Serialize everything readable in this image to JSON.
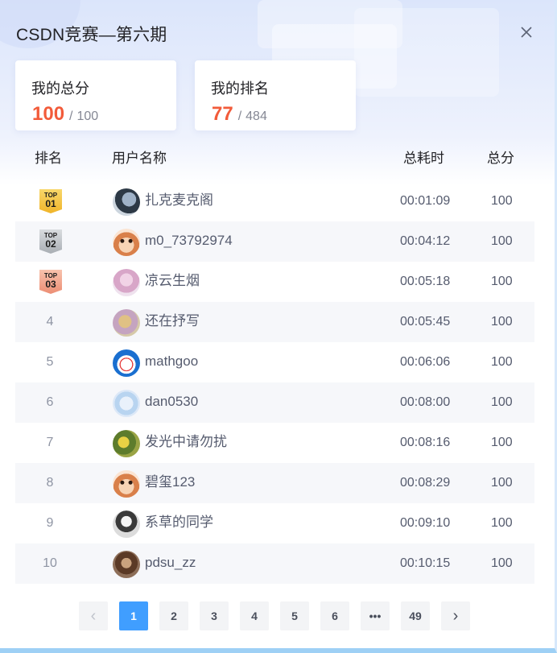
{
  "dialog": {
    "title": "CSDN竞赛—第六期",
    "close_icon": "close-icon"
  },
  "stats": {
    "total_score": {
      "label": "我的总分",
      "value": "100",
      "max": "100"
    },
    "rank": {
      "label": "我的排名",
      "value": "77",
      "total": "484"
    }
  },
  "table": {
    "headers": {
      "rank": "排名",
      "user": "用户名称",
      "time": "总耗时",
      "score": "总分"
    },
    "rows": [
      {
        "rank": "1",
        "top_label": "TOP",
        "top_num": "01",
        "name": "扎克麦克阁",
        "time": "00:01:09",
        "score": "100"
      },
      {
        "rank": "2",
        "top_label": "TOP",
        "top_num": "02",
        "name": "m0_73792974",
        "time": "00:04:12",
        "score": "100"
      },
      {
        "rank": "3",
        "top_label": "TOP",
        "top_num": "03",
        "name": "凉云生烟",
        "time": "00:05:18",
        "score": "100"
      },
      {
        "rank": "4",
        "name": "还在抒写",
        "time": "00:05:45",
        "score": "100"
      },
      {
        "rank": "5",
        "name": "mathgoo",
        "time": "00:06:06",
        "score": "100"
      },
      {
        "rank": "6",
        "name": "dan0530",
        "time": "00:08:00",
        "score": "100"
      },
      {
        "rank": "7",
        "name": "发光中请勿扰",
        "time": "00:08:16",
        "score": "100"
      },
      {
        "rank": "8",
        "name": "碧玺123",
        "time": "00:08:29",
        "score": "100"
      },
      {
        "rank": "9",
        "name": "系草的同学",
        "time": "00:09:10",
        "score": "100"
      },
      {
        "rank": "10",
        "name": "pdsu_zz",
        "time": "00:10:15",
        "score": "100"
      }
    ]
  },
  "pagination": {
    "prev": "‹",
    "pages": [
      "1",
      "2",
      "3",
      "4",
      "5",
      "6"
    ],
    "ellipsis": "•••",
    "last": "49",
    "next": "›",
    "current": "1"
  },
  "colors": {
    "accent": "#409eff",
    "highlight": "#f25b3a",
    "gold": "#f6c343",
    "silver": "#bfc3c9",
    "bronze": "#f3a48c"
  }
}
